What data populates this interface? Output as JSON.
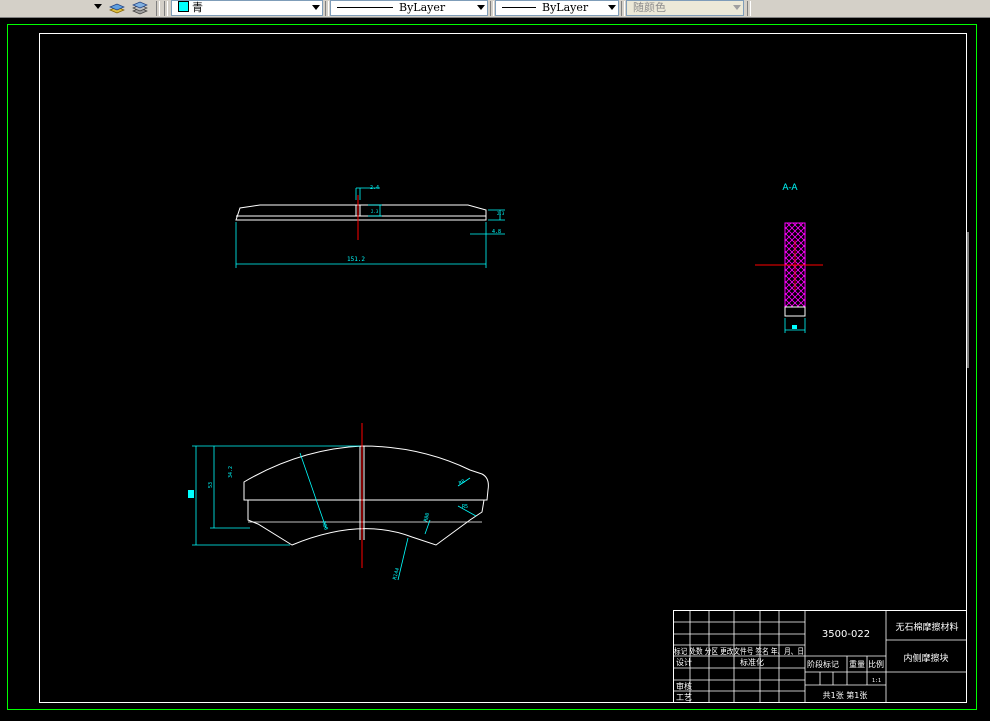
{
  "toolbar": {
    "color_value": "青",
    "color_hex": "#00ffff",
    "linetype_value": "ByLayer",
    "lineweight_value": "ByLayer",
    "plotstyle_value": "随颜色"
  },
  "drawing": {
    "section_label": "A-A",
    "dim_top_width": "2.4",
    "dim_top_h1": "2.3",
    "dim_top_h2": "2.3",
    "dim_top_bottom": "4.8",
    "dim_top_length": "151.2",
    "dim_height_outer": "53",
    "dim_height_inner": "34.2",
    "dim_r_big": "R88",
    "dim_r_corner": "R8",
    "dim_r_small": "R5",
    "dim_r_bottom": "R144",
    "dim_r_upper": "R80"
  },
  "title_block": {
    "drawing_number": "3500-022",
    "material": "无石棉摩擦材料",
    "part_name": "内侧摩擦块",
    "row_headers": "标记 处数  分区  更改文件号  签名  年、月、日",
    "design_label": "设计",
    "standardize_label": "标准化",
    "review_label": "审核",
    "process_label": "工艺",
    "stage_mark_label": "阶段标记",
    "weight_label": "重量",
    "scale_label": "比例",
    "scale_value": "1:1",
    "sheets_label": "共1张  第1张"
  },
  "colors": {
    "background": "#000000",
    "outline": "#ffffff",
    "dimension": "#00ffff",
    "centerline": "#ff0000",
    "hatch": "#ff00ff",
    "border": "#00ff00"
  }
}
